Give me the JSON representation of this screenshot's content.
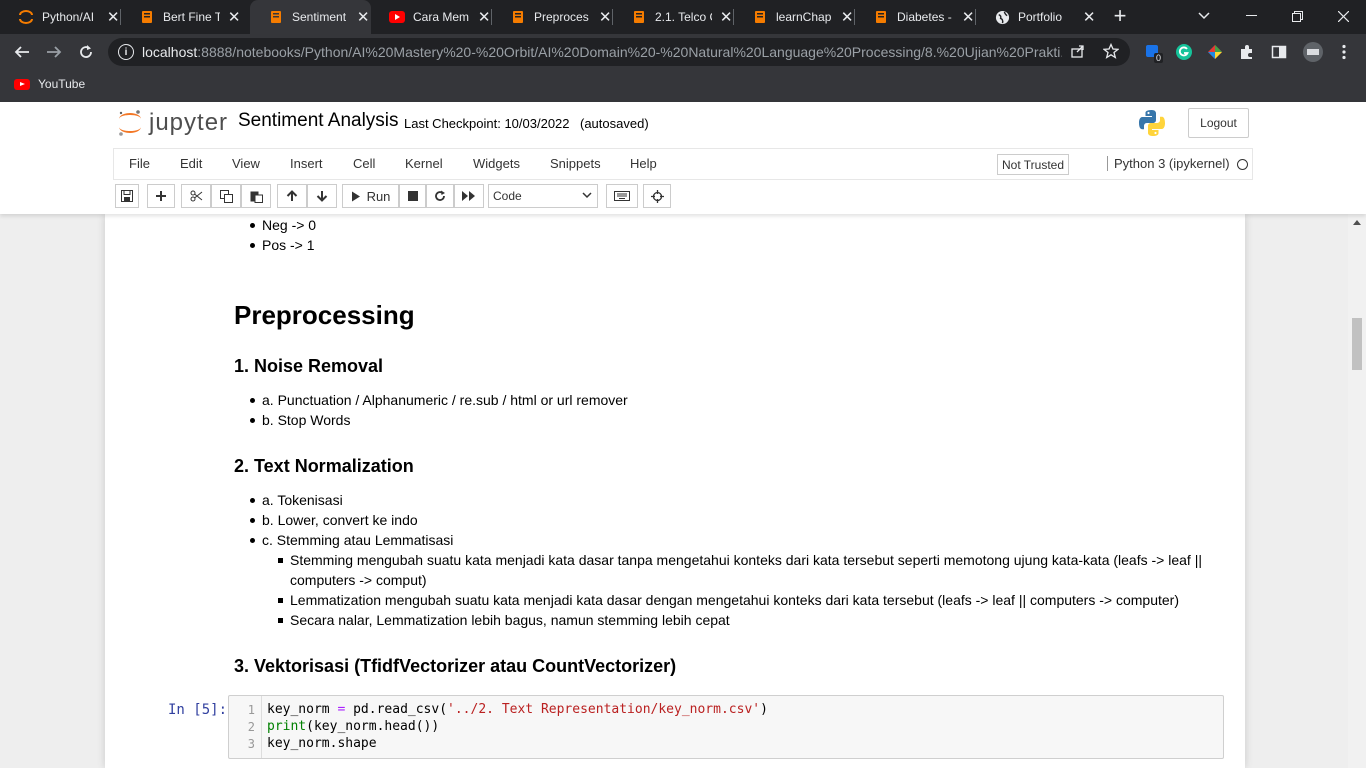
{
  "browser": {
    "tabs": [
      {
        "label": "Python/AI",
        "icon": "jupyter-icon"
      },
      {
        "label": "Bert Fine T",
        "icon": "notebook-icon"
      },
      {
        "label": "Sentiment",
        "icon": "notebook-icon",
        "active": true
      },
      {
        "label": "Cara Mem",
        "icon": "youtube-icon"
      },
      {
        "label": "Preproces",
        "icon": "notebook-icon"
      },
      {
        "label": "2.1. Telco C",
        "icon": "notebook-icon"
      },
      {
        "label": "learnChap",
        "icon": "notebook-icon"
      },
      {
        "label": "Diabetes -",
        "icon": "notebook-icon"
      },
      {
        "label": "Portfolio",
        "icon": "globe-icon"
      }
    ],
    "url_host": "localhost",
    "url_rest": ":8888/notebooks/Python/AI%20Mastery%20-%20Orbit/AI%20Domain%20-%20Natural%20Language%20Processing/8.%20Ujian%20Prakti...",
    "bookmark": "YouTube",
    "extension_badge": "0",
    "colors": {
      "tabbar": "#202124",
      "toolbar": "#35363a",
      "tab_icon_orange": "#f57c00"
    }
  },
  "jupyter": {
    "logo_text": "jupyter",
    "notebook_title": "Sentiment Analysis",
    "checkpoint": "Last Checkpoint: 10/03/2022",
    "autosave": "(autosaved)",
    "logout": "Logout",
    "menu": [
      "File",
      "Edit",
      "View",
      "Insert",
      "Cell",
      "Kernel",
      "Widgets",
      "Snippets",
      "Help"
    ],
    "trust": "Not Trusted",
    "kernel": "Python 3 (ipykernel)",
    "toolbar": {
      "run": "Run",
      "cell_type": "Code"
    }
  },
  "notebook": {
    "top_list": [
      "Neg -> 0",
      "Pos -> 1"
    ],
    "h_preprocessing": "Preprocessing",
    "h_noise": "1. Noise Removal",
    "noise_items": [
      "a. Punctuation / Alphanumeric / re.sub / html or url remover",
      "b. Stop Words"
    ],
    "h_normalization": "2. Text Normalization",
    "norm_items": [
      "a. Tokenisasi",
      "b. Lower, convert ke indo",
      "c. Stemming atau Lemmatisasi"
    ],
    "norm_sub_items": [
      "Stemming mengubah suatu kata menjadi kata dasar tanpa mengetahui konteks dari kata tersebut seperti memotong ujung kata-kata (leafs -> leaf ||",
      "computers -> comput)",
      "Lemmatization mengubah suatu kata menjadi kata dasar dengan mengetahui konteks dari kata tersebut (leafs -> leaf || computers -> computer)",
      "Secara nalar, Lemmatization lebih bagus, namun stemming lebih cepat"
    ],
    "h_vectorization": "3. Vektorisasi (TfidfVectorizer atau CountVectorizer)",
    "code_prompt": "In [5]:",
    "code_lines": {
      "l1_var": "key_norm",
      "l1_eq": " = ",
      "l1_call": "pd.read_csv(",
      "l1_str": "'../2. Text Representation/key_norm.csv'",
      "l1_end": ")",
      "l2_kw": "print",
      "l2_rest": "(key_norm.head())",
      "l3": "key_norm.shape"
    },
    "line_numbers": [
      "1",
      "2",
      "3"
    ]
  }
}
